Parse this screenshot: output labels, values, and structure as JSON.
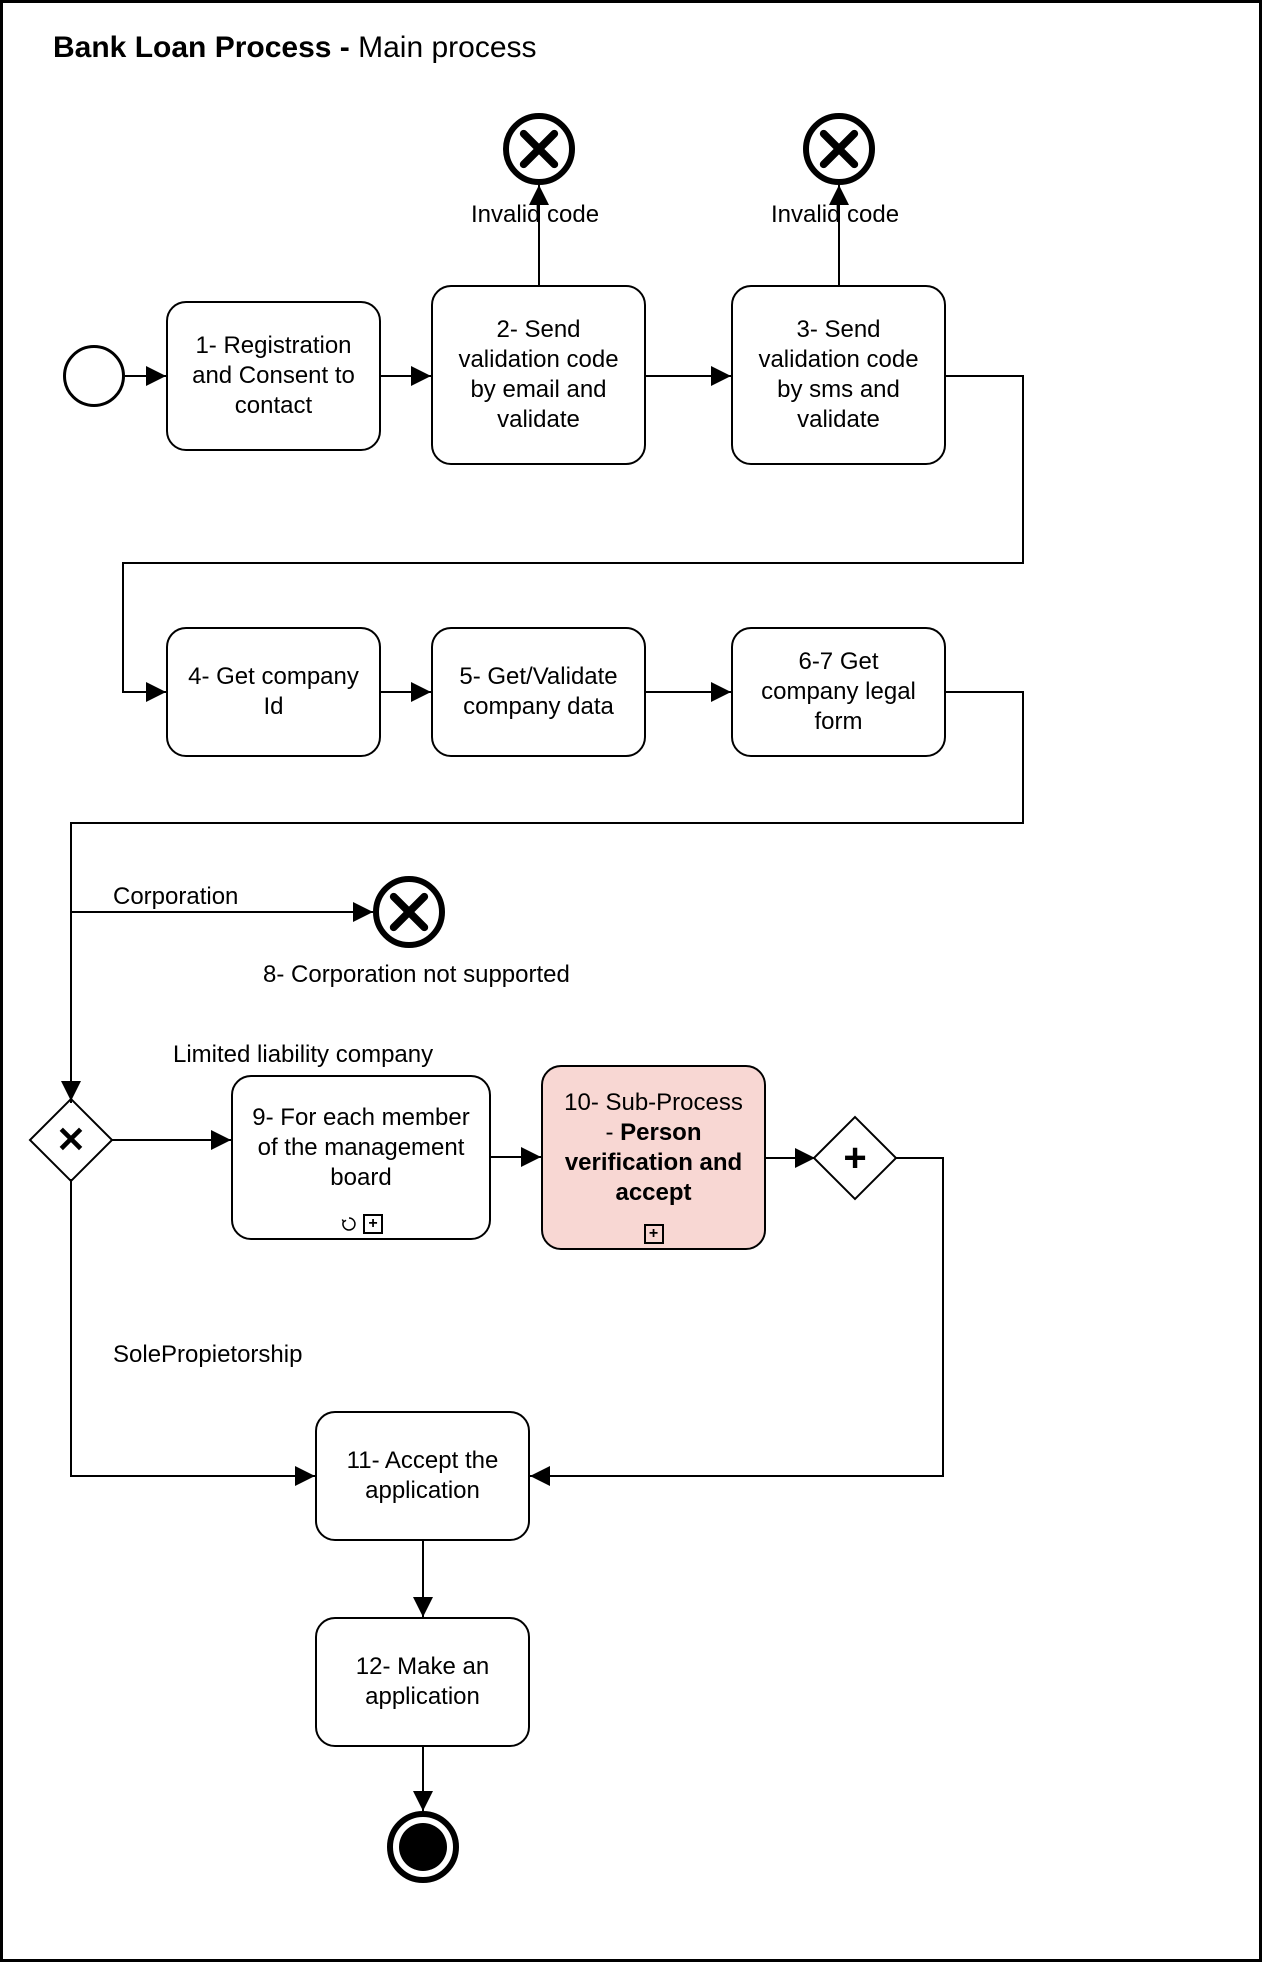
{
  "title_bold": "Bank Loan Process - ",
  "title_rest": "Main process",
  "tasks": {
    "t1": "1- Registration and Consent to contact",
    "t2": "2- Send validation code by email and validate",
    "t3": "3- Send validation code by sms and validate",
    "t4": "4- Get company Id",
    "t5": "5- Get/Validate company data",
    "t6": "6-7 Get company legal form",
    "t9": "9- For each member of the management board",
    "t10a": "10- Sub-Process - ",
    "t10b": "Person verification and accept",
    "t11": "11- Accept the application",
    "t12": "12- Make an application"
  },
  "labels": {
    "invalid1": "Invalid code",
    "invalid2": "Invalid code",
    "corp": "Corporation",
    "llc": "Limited liability company",
    "sole": "SolePropietorship",
    "corp_not_supported": "8- Corporation not supported"
  }
}
